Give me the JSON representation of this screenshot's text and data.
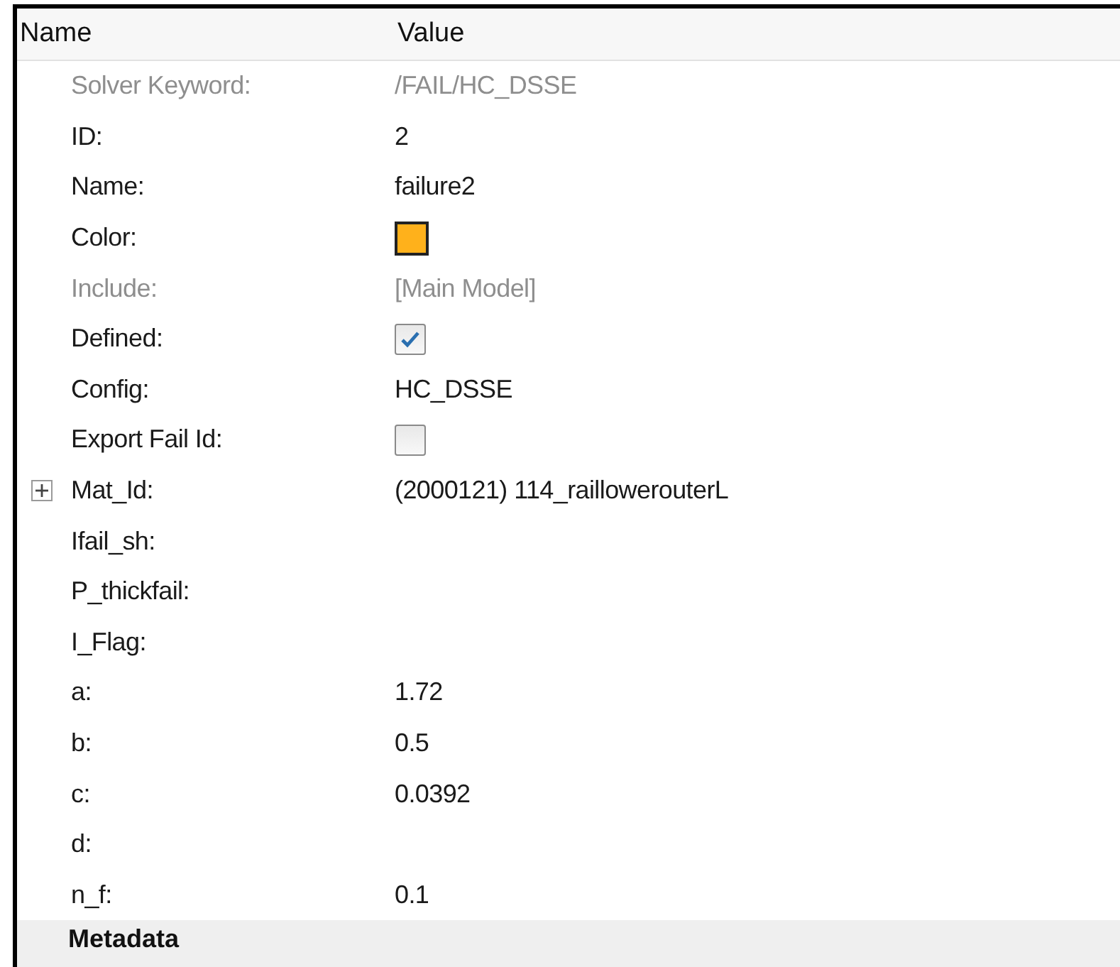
{
  "header": {
    "columns": [
      "Name",
      "Value"
    ]
  },
  "rows": [
    {
      "label": "Solver Keyword:",
      "kind": "text",
      "value": "/FAIL/HC_DSSE",
      "disabled": true
    },
    {
      "label": "ID:",
      "kind": "text",
      "value": "2",
      "disabled": false
    },
    {
      "label": "Name:",
      "kind": "text",
      "value": "failure2",
      "disabled": false
    },
    {
      "label": "Color:",
      "kind": "color",
      "color": "#ffb11b",
      "disabled": false
    },
    {
      "label": "Include:",
      "kind": "text",
      "value": "[Main Model]",
      "disabled": true
    },
    {
      "label": "Defined:",
      "kind": "checkbox",
      "checked": true,
      "disabled": false
    },
    {
      "label": "Config:",
      "kind": "text",
      "value": "HC_DSSE",
      "disabled": false
    },
    {
      "label": "Export Fail Id:",
      "kind": "checkbox",
      "checked": false,
      "disabled": false
    },
    {
      "label": "Mat_Id:",
      "kind": "text",
      "value": "(2000121) 114_raillowerouterL",
      "disabled": false,
      "expanded": false
    },
    {
      "label": "Ifail_sh:",
      "kind": "text",
      "disabled": false
    },
    {
      "label": "P_thickfail:",
      "kind": "text",
      "disabled": false
    },
    {
      "label": "I_Flag:",
      "kind": "text",
      "disabled": false
    },
    {
      "label": "a:",
      "kind": "text",
      "value": "1.72",
      "disabled": false
    },
    {
      "label": "b:",
      "kind": "text",
      "value": "0.5",
      "disabled": false
    },
    {
      "label": "c:",
      "kind": "text",
      "value": "0.0392",
      "disabled": false
    },
    {
      "label": "d:",
      "kind": "text",
      "disabled": false
    },
    {
      "label": "n_f:",
      "kind": "text",
      "value": "0.1",
      "disabled": false
    }
  ],
  "section": {
    "title": "Metadata"
  }
}
